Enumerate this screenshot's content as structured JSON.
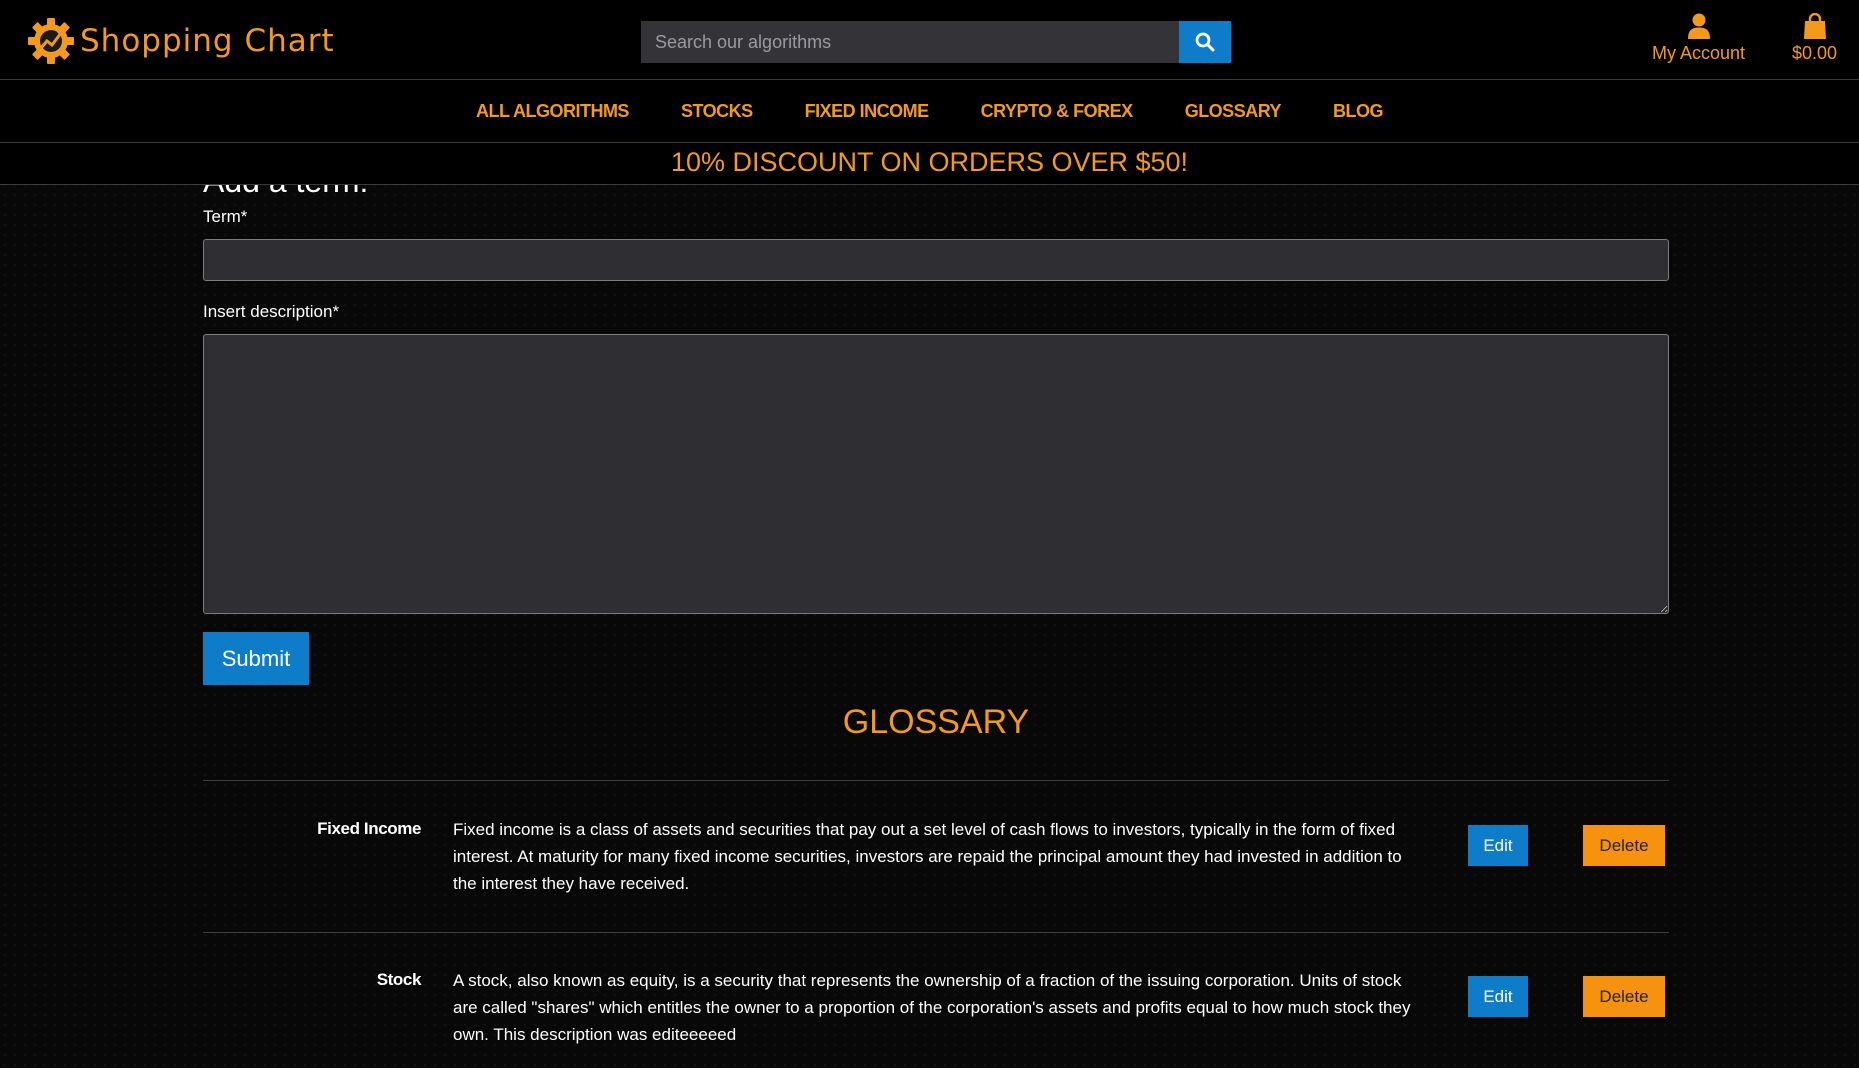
{
  "brand": {
    "name": "Shopping Chart",
    "logo_icon": "gear-chart-logo",
    "accent": "#f39a1d",
    "primary": "#0e7dc9"
  },
  "search": {
    "placeholder": "Search our algorithms",
    "value": "",
    "icon": "search-icon"
  },
  "account": {
    "label": "My Account",
    "icon": "user-icon"
  },
  "cart": {
    "total": "$0.00",
    "icon": "shopping-bag-icon"
  },
  "nav": {
    "items": [
      {
        "label": "ALL ALGORITHMS"
      },
      {
        "label": "STOCKS"
      },
      {
        "label": "FIXED INCOME"
      },
      {
        "label": "CRYPTO & FOREX"
      },
      {
        "label": "GLOSSARY"
      },
      {
        "label": "BLOG"
      }
    ]
  },
  "promo": {
    "text": "10% DISCOUNT ON ORDERS OVER $50!"
  },
  "form": {
    "heading": "Add a term:",
    "term_label": "Term*",
    "term_value": "",
    "description_label": "Insert description*",
    "description_value": "",
    "submit_label": "Submit"
  },
  "glossary": {
    "title": "GLOSSARY",
    "edit_label": "Edit",
    "delete_label": "Delete",
    "entries": [
      {
        "term": "Fixed Income",
        "description": "Fixed income is a class of assets and securities that pay out a set level of cash flows to investors, typically in the form of fixed interest. At maturity for many fixed income securities, investors are repaid the principal amount they had invested in addition to the interest they have received."
      },
      {
        "term": "Stock",
        "description": "A stock, also known as equity, is a security that represents the ownership of a fraction of the issuing corporation. Units of stock are called \"shares\" which entitles the owner to a proportion of the corporation's assets and profits equal to how much stock they own. This description was editeeeeed"
      }
    ]
  }
}
